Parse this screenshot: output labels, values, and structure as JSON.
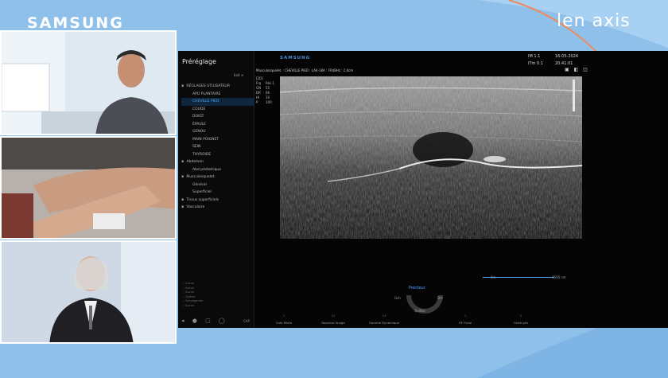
{
  "brand": {
    "left_logo": "SAMSUNG",
    "right_logo": "len axis"
  },
  "colors": {
    "background": "#8fc0ea",
    "accent_curve": "#f08a5d",
    "screen_bg": "#050505",
    "selection": "#4aa8ff"
  },
  "ultrasound": {
    "header_brand": "SAMSUNG",
    "info_line": "Musculosquelet. : CHEVILLE PIED : LA4-18A : FR48Hz : 2.0cm",
    "params": [
      {
        "k": "Frq",
        "v": "Rés.1"
      },
      {
        "k": "GN",
        "v": "55"
      },
      {
        "k": "DR",
        "v": "66"
      },
      {
        "k": "HI",
        "v": "10"
      },
      {
        "k": "P",
        "v": "100"
      }
    ],
    "mode_tag": "[2D]",
    "meta": {
      "im": "IM  1.1",
      "itm": "ITm 0.1",
      "date": "16-05-2024",
      "time": "20:41:01"
    },
    "tool_icons": "▣ ◧ ◫",
    "depth_start": "0m",
    "depth_end": "4560 cm",
    "pointer": {
      "title": "Pointeur",
      "left": "Gch",
      "right": "Drt",
      "bottom": "Quitter"
    },
    "softkeys": [
      {
        "num": "1",
        "label": "Crée Mixte"
      },
      {
        "num": "12",
        "label": "Repense Image"
      },
      {
        "num": "14",
        "label": "Gamme Dynamique"
      },
      {
        "num": "1",
        "label": "HF Focal"
      },
      {
        "num": "2",
        "label": "Carte gris"
      }
    ]
  },
  "presets": {
    "title": "Préréglage",
    "exit_label": "Exit  ✕",
    "items": [
      {
        "label": "RÉGLAGES UTILISATEUR",
        "kind": "folder"
      },
      {
        "label": "APO PLANTAIRE",
        "kind": "child"
      },
      {
        "label": "CHEVILLE PIED",
        "kind": "child",
        "selected": true
      },
      {
        "label": "COUDE",
        "kind": "child"
      },
      {
        "label": "DOIGT",
        "kind": "child"
      },
      {
        "label": "ÉPAULE",
        "kind": "child"
      },
      {
        "label": "GENOU",
        "kind": "child"
      },
      {
        "label": "MAIN POIGNET",
        "kind": "child"
      },
      {
        "label": "SEIN",
        "kind": "child"
      },
      {
        "label": "THYROIDE",
        "kind": "child"
      },
      {
        "label": "Abdomen",
        "kind": "folder"
      },
      {
        "label": "Abd pédiatrique",
        "kind": "child"
      },
      {
        "label": "Musculosquelet.",
        "kind": "folder"
      },
      {
        "label": "Général",
        "kind": "child"
      },
      {
        "label": "Superficiel",
        "kind": "child"
      },
      {
        "label": "Tissus superficiels",
        "kind": "folder"
      },
      {
        "label": "Vasculaire",
        "kind": "folder"
      }
    ],
    "legend": [
      "Aucun",
      "Aucun",
      "Aucun",
      "Quitter",
      "Sauvegarder",
      "Aucun"
    ],
    "bottom_icons": "◂ ● ▢ ◯",
    "cap_label": "CAP"
  }
}
